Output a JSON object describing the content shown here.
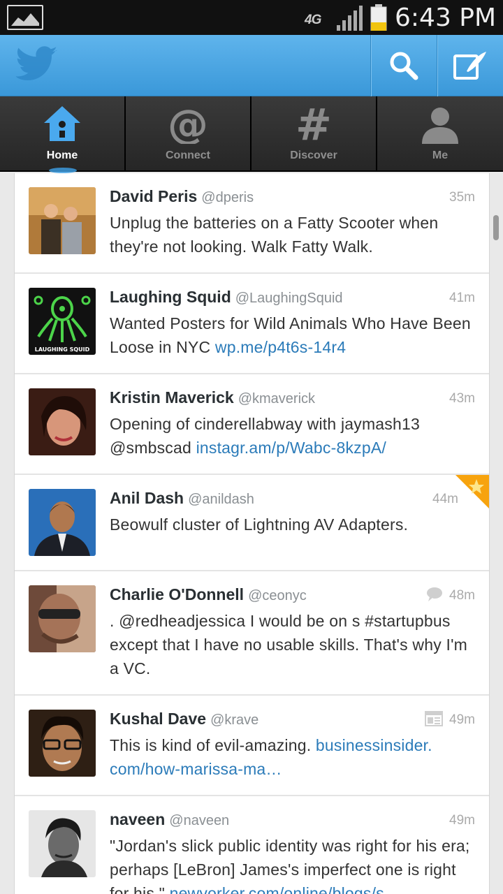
{
  "status": {
    "network": "4G",
    "time": "6:43 PM"
  },
  "tabs": [
    {
      "label": "Home",
      "icon": "home-icon",
      "active": true
    },
    {
      "label": "Connect",
      "icon": "at-icon",
      "active": false
    },
    {
      "label": "Discover",
      "icon": "hash-icon",
      "active": false
    },
    {
      "label": "Me",
      "icon": "person-icon",
      "active": false
    }
  ],
  "tweets": [
    {
      "name": "David Peris",
      "handle": "@dperis",
      "time": "35m",
      "text": "Unplug the batteries on a Fatty Scooter when they're not looking.   Walk Fatty Walk.",
      "link": ""
    },
    {
      "name": "Laughing Squid",
      "handle": "@LaughingSquid",
      "time": "41m",
      "text": "Wanted Posters for Wild Animals Who Have Been Loose in NYC ",
      "link": "wp.me/p4t6s-14r4",
      "avatar_caption": "LAUGHING SQUID"
    },
    {
      "name": "Kristin Maverick",
      "handle": "@kmaverick",
      "time": "43m",
      "text": "Opening of cinderellabway with jaymash13 @smbscad ",
      "link": "instagr.am/p/Wabc-8kzpA/"
    },
    {
      "name": "Anil Dash",
      "handle": "@anildash",
      "time": "44m",
      "text": "Beowulf cluster of Lightning AV Adapters.",
      "link": ""
    },
    {
      "name": "Charlie O'Donnell",
      "handle": "@ceonyc",
      "time": "48m",
      "text": ". @redheadjessica I would be on s #startupbus except that I have no usable skills.  That's why I'm a VC.",
      "link": ""
    },
    {
      "name": "Kushal Dave",
      "handle": "@krave",
      "time": "49m",
      "text": "This is kind of evil-amazing. ",
      "link": "businessinsider.​com/how-marissa-ma…"
    },
    {
      "name": "naveen",
      "handle": "@naveen",
      "time": "49m",
      "text": "\"Jordan's slick public identity was right for his era; perhaps [LeBron] James's imperfect one is right for his.\" ",
      "link": "newyorker.com/online/blogs/s…"
    }
  ]
}
